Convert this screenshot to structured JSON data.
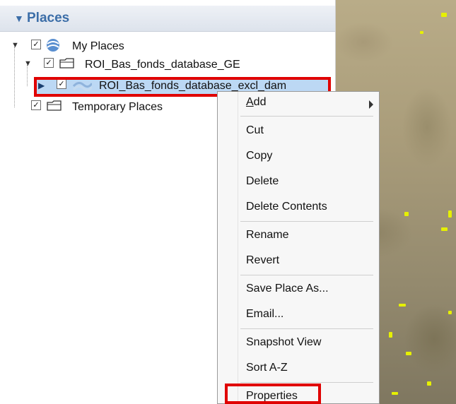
{
  "panel": {
    "title": "Places",
    "items": [
      {
        "label": "My Places",
        "checked": true,
        "icon": "earth-places-icon"
      },
      {
        "label": "ROI_Bas_fonds_database_GE",
        "checked": true,
        "icon": "folder-icon"
      },
      {
        "label": "ROI_Bas_fonds_database_excl_dam",
        "checked": true,
        "icon": "layer-wave-icon",
        "selected": true
      },
      {
        "label": "Temporary Places",
        "checked": true,
        "icon": "folder-icon"
      }
    ]
  },
  "context_menu": {
    "items": [
      {
        "accel": "A",
        "rest": "dd",
        "has_submenu": true
      },
      {
        "label": "Cut"
      },
      {
        "label": "Copy"
      },
      {
        "label": "Delete"
      },
      {
        "label": "Delete Contents"
      },
      {
        "label": "Rename"
      },
      {
        "label": "Revert"
      },
      {
        "label": "Save Place As..."
      },
      {
        "label": "Email..."
      },
      {
        "label": "Snapshot View"
      },
      {
        "label": "Sort A-Z"
      },
      {
        "label": "Properties",
        "highlighted": true
      }
    ]
  },
  "colors": {
    "highlight_box": "#e00000",
    "selection": "#bcd8f4",
    "header_text": "#3c6ea8"
  }
}
